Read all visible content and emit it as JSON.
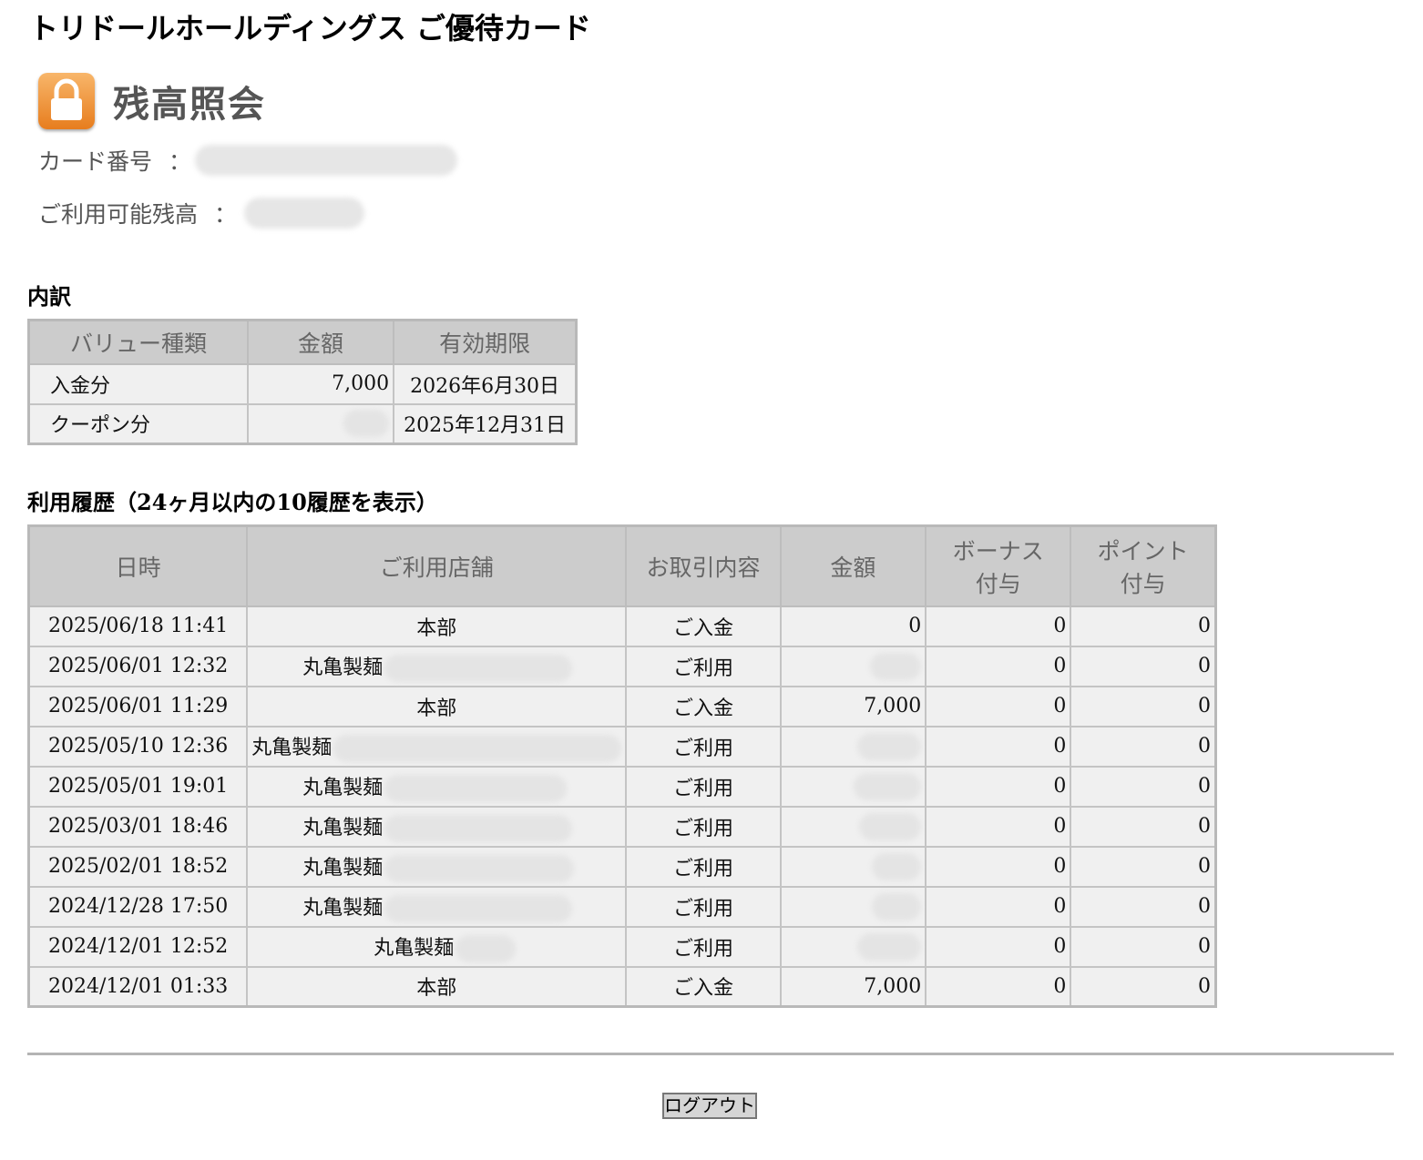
{
  "page_title": "トリドールホールディングス ご優待カード",
  "section": {
    "title": "残高照会",
    "icon": "lock-icon"
  },
  "card": {
    "number_label": "カード番号",
    "balance_label": "ご利用可能残高",
    "separator": "："
  },
  "breakdown": {
    "heading": "内訳",
    "headers": [
      "バリュー種類",
      "金額",
      "有効期限"
    ],
    "rows": [
      {
        "type": "入金分",
        "amount": "7,000",
        "expiry": "2026年6月30日"
      },
      {
        "type": "クーポン分",
        "amount": "",
        "expiry": "2025年12月31日"
      }
    ]
  },
  "history": {
    "heading": "利用履歴（24ヶ月以内の10履歴を表示）",
    "headers": {
      "date": "日時",
      "store": "ご利用店舗",
      "type": "お取引内容",
      "amount": "金額",
      "bonus_1": "ボーナス",
      "bonus_2": "付与",
      "point_1": "ポイント",
      "point_2": "付与"
    },
    "rows": [
      {
        "date": "2025/06/18 11:41",
        "store": "本部",
        "type": "ご入金",
        "amount": "0",
        "bonus": "0",
        "point": "0"
      },
      {
        "date": "2025/06/01 12:32",
        "store": "丸亀製麺",
        "type": "ご利用",
        "amount": "",
        "bonus": "0",
        "point": "0"
      },
      {
        "date": "2025/06/01 11:29",
        "store": "本部",
        "type": "ご入金",
        "amount": "7,000",
        "bonus": "0",
        "point": "0"
      },
      {
        "date": "2025/05/10 12:36",
        "store": "丸亀製麺",
        "type": "ご利用",
        "amount": "",
        "bonus": "0",
        "point": "0"
      },
      {
        "date": "2025/05/01 19:01",
        "store": "丸亀製麺",
        "type": "ご利用",
        "amount": "",
        "bonus": "0",
        "point": "0"
      },
      {
        "date": "2025/03/01 18:46",
        "store": "丸亀製麺",
        "type": "ご利用",
        "amount": "",
        "bonus": "0",
        "point": "0"
      },
      {
        "date": "2025/02/01 18:52",
        "store": "丸亀製麺",
        "type": "ご利用",
        "amount": "",
        "bonus": "0",
        "point": "0"
      },
      {
        "date": "2024/12/28 17:50",
        "store": "丸亀製麺",
        "type": "ご利用",
        "amount": "",
        "bonus": "0",
        "point": "0"
      },
      {
        "date": "2024/12/01 12:52",
        "store": "丸亀製麺",
        "type": "ご利用",
        "amount": "",
        "bonus": "0",
        "point": "0"
      },
      {
        "date": "2024/12/01 01:33",
        "store": "本部",
        "type": "ご入金",
        "amount": "7,000",
        "bonus": "0",
        "point": "0"
      }
    ]
  },
  "logout_label": "ログアウト"
}
